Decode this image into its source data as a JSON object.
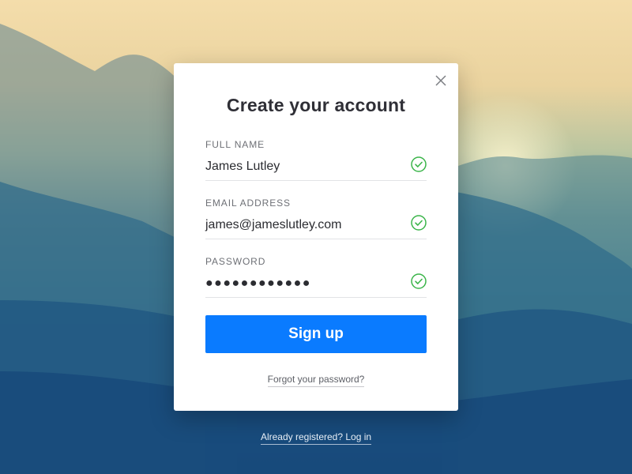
{
  "modal": {
    "title": "Create your account",
    "close_icon": "close-icon"
  },
  "fields": [
    {
      "label": "FULL NAME",
      "value": "James Lutley",
      "status_icon": "check-circle-icon"
    },
    {
      "label": "EMAIL ADDRESS",
      "value": "james@jameslutley.com",
      "status_icon": "check-circle-icon"
    },
    {
      "label": "PASSWORD",
      "value": "●●●●●●●●●●●●",
      "status_icon": "check-circle-icon"
    }
  ],
  "actions": {
    "signup_label": "Sign up",
    "forgot_label": "Forgot your password?",
    "already_label": "Already registered? Log in"
  },
  "colors": {
    "primary": "#0a7bff",
    "valid": "#3bb54a",
    "text": "#2f2f36"
  }
}
